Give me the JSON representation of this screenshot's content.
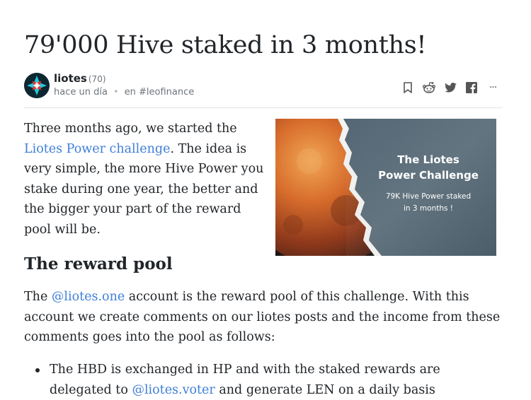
{
  "post": {
    "title": "79'000 Hive staked in 3 months!",
    "author": "liotes",
    "reputation": "(70)",
    "time": "hace un día",
    "community_prefix": "en",
    "community": "#leofinance"
  },
  "actions": {
    "icons": [
      "bookmark-icon",
      "reddit-icon",
      "twitter-icon",
      "facebook-icon",
      "more-icon"
    ],
    "more_glyph": "···"
  },
  "body": {
    "p1_a": "Three months ago, we started the ",
    "p1_link": "Liotes Power challenge",
    "p1_b": ". The idea is very simple, the more Hive Power you stake during one year, the better and the bigger your part of the reward pool will be.",
    "hero": {
      "title_line1": "The Liotes",
      "title_line2": "Power Challenge",
      "subtitle_line1": "79K Hive Power staked",
      "subtitle_line2": "in 3 months !"
    },
    "h2": "The reward pool",
    "p2_a": "The ",
    "p2_link": "@liotes.one",
    "p2_b": " account is the reward pool of this challenge. With this account we create comments on our liotes posts and the income from these comments goes into the pool as follows:",
    "li1_a": "The HBD is exchanged in HP and with the staked rewards are delegated to ",
    "li1_link": "@liotes.voter",
    "li1_b": " and generate LEN on a daily basis"
  },
  "colors": {
    "link": "#3f7fd8",
    "text": "#212529",
    "muted": "#6c757d"
  }
}
